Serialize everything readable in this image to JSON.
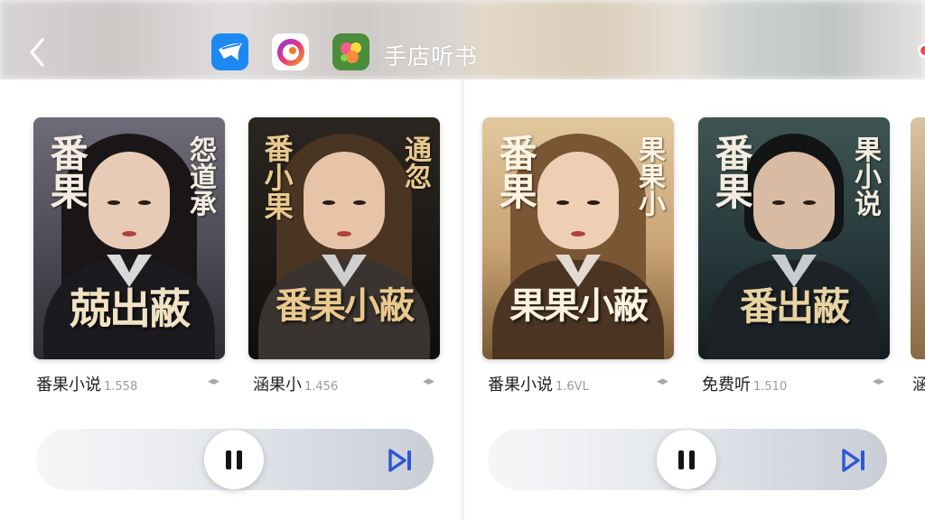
{
  "header": {
    "title": "手店听书",
    "apps": [
      {
        "name": "paper-plane-app"
      },
      {
        "name": "camera-ring-app"
      },
      {
        "name": "flower-game-app"
      }
    ]
  },
  "books": [
    {
      "caption": "番果小说",
      "count": "1.558",
      "side_text": "番果",
      "side_text_r": "怨道承",
      "title_art": "兢出蔽"
    },
    {
      "caption": "涵果小",
      "count": "1.456",
      "side_text": "番小果",
      "side_text_r": "通忽",
      "title_art": "番果小蔽"
    },
    {
      "caption": "番果小说",
      "count": "1.6VL",
      "side_text": "番果",
      "side_text_r": "果果小",
      "title_art": "果果小蔽"
    },
    {
      "caption": "免费听",
      "count": "1.510",
      "side_text": "番果",
      "side_text_r": "果小说",
      "title_art": "番出蔽"
    }
  ],
  "peek": {
    "caption": "涵"
  },
  "players": [
    {
      "state": "playing"
    },
    {
      "state": "playing"
    }
  ],
  "colors": {
    "accent_blue": "#2e56d6",
    "background": "#ffffff"
  }
}
